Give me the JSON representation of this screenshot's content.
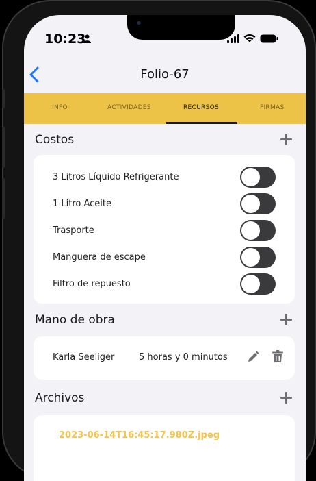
{
  "status_bar": {
    "time": "10:23"
  },
  "nav": {
    "title": "Folio-67"
  },
  "tabs": [
    {
      "label": "INFO",
      "active": false
    },
    {
      "label": "ACTIVIDADES",
      "active": false
    },
    {
      "label": "RECURSOS",
      "active": true
    },
    {
      "label": "FIRMAS",
      "active": false
    }
  ],
  "costos": {
    "title": "Costos",
    "items": [
      {
        "label": "3 Litros Líquido Refrigerante",
        "enabled": false
      },
      {
        "label": "1 Litro Aceite",
        "enabled": false
      },
      {
        "label": "Trasporte",
        "enabled": false
      },
      {
        "label": "Manguera de escape",
        "enabled": false
      },
      {
        "label": "Filtro de repuesto",
        "enabled": false
      }
    ]
  },
  "mano_de_obra": {
    "title": "Mano de obra",
    "items": [
      {
        "name": "Karla Seeliger",
        "duration": "5 horas y 0 minutos"
      }
    ]
  },
  "archivos": {
    "title": "Archivos",
    "items": [
      {
        "filename": "2023-06-14T16:45:17.980Z.jpeg"
      }
    ]
  },
  "colors": {
    "accent": "#edc347",
    "file_link": "#f5c34a",
    "back_arrow": "#1e78ff",
    "toggle_off": "#3a3a3c"
  },
  "icons": {
    "back": "chevron-left-icon",
    "add": "plus-icon",
    "edit": "pencil-icon",
    "delete": "trash-icon",
    "signal": "signal-icon",
    "wifi": "wifi-icon",
    "battery": "battery-icon"
  }
}
